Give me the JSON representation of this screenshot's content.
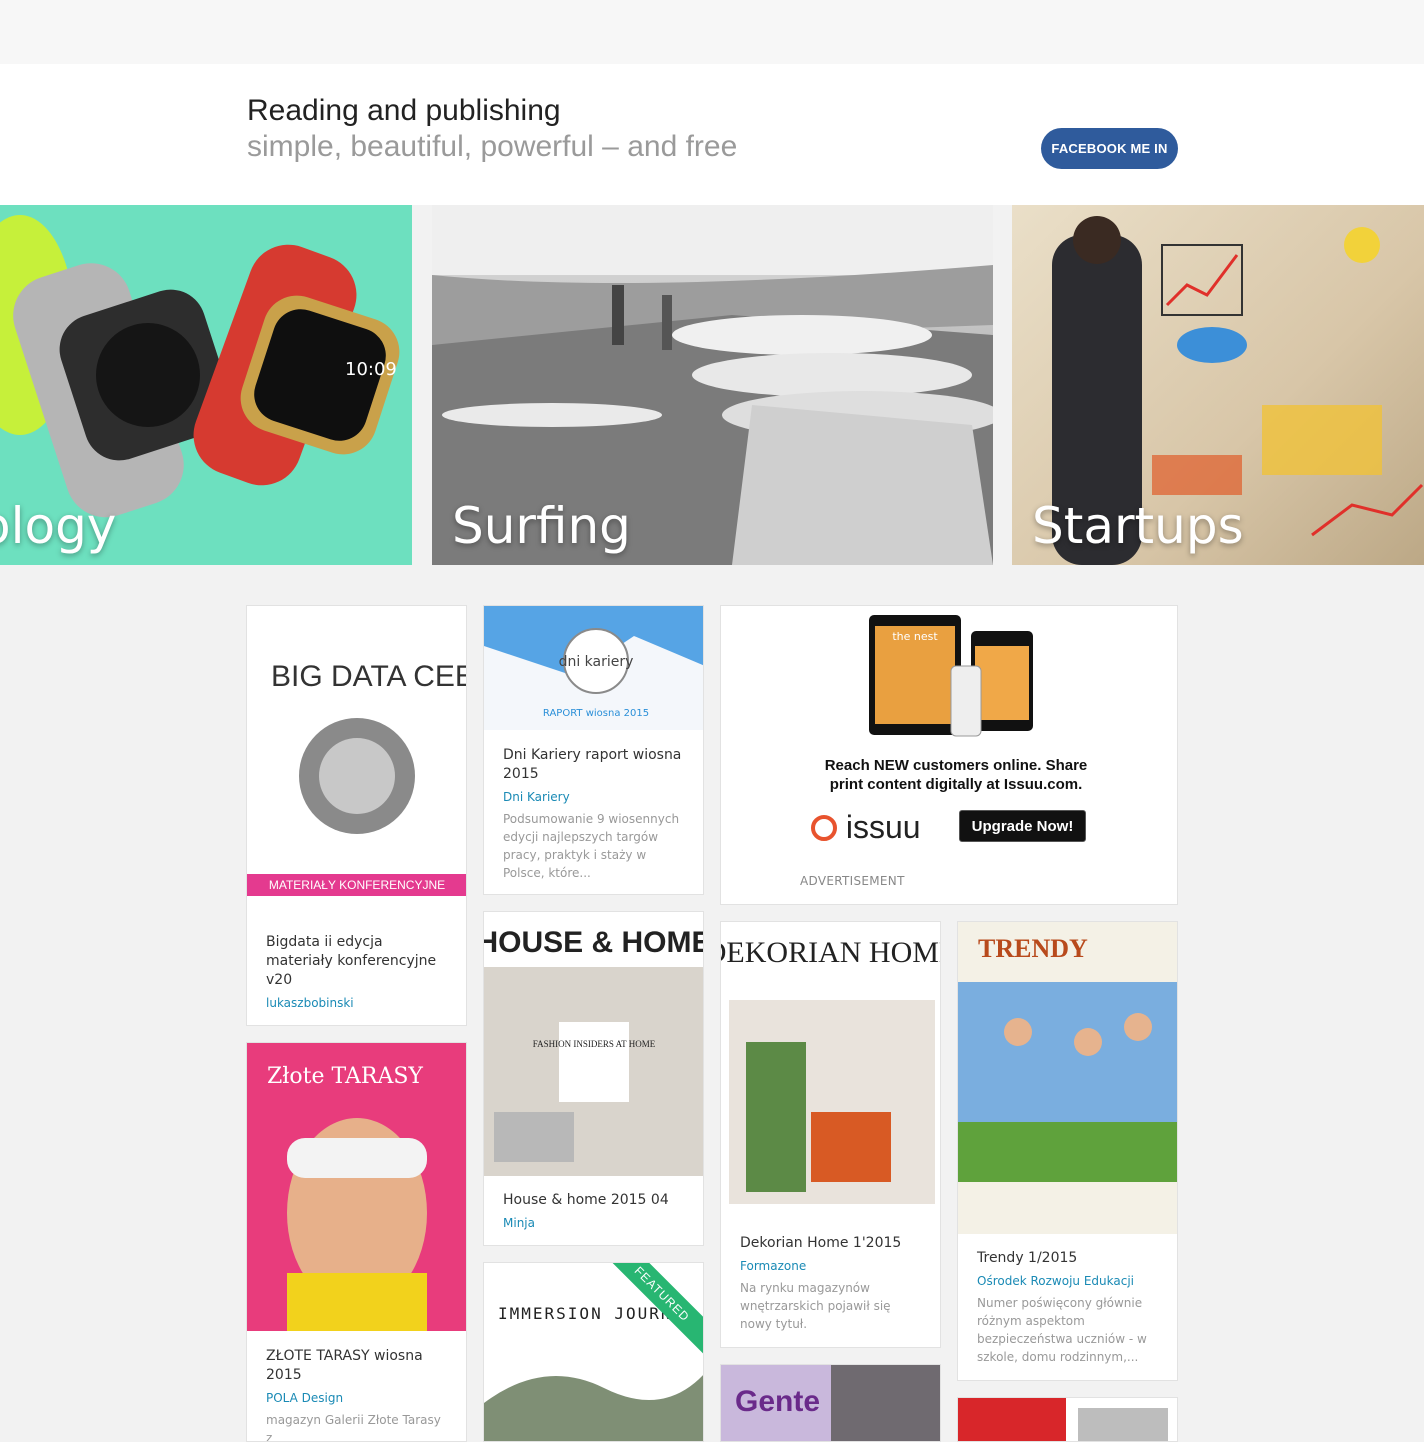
{
  "hero": {
    "title": "Reading and publishing",
    "subtitle": "simple, beautiful, powerful – and free",
    "facebook_button": "FACEBOOK ME IN"
  },
  "categories": [
    {
      "label": "Technology",
      "visible_text": "ology",
      "color": "#6de0bf"
    },
    {
      "label": "Surfing"
    },
    {
      "label": "Startups"
    }
  ],
  "ad": {
    "tagline": "Reach NEW customers online. Share print content digitally at Issuu.com.",
    "brand": "issuu",
    "upgrade_button": "Upgrade Now!",
    "label": "ADVERTISEMENT",
    "device_title": "the nest"
  },
  "publications": [
    {
      "title": "Bigdata ii edycja materiały konferencyjne v20",
      "author": "lukaszbobinski",
      "cover_text": "BIG DATA CEE CONGRESS",
      "cover_sub": "MATERIAŁY KONFERENCYJNE"
    },
    {
      "title": "Dni Kariery raport wiosna 2015",
      "author": "Dni Kariery",
      "description": "Podsumowanie 9 wiosennych edycji najlepszych targów pracy, praktyk i staży w Polsce, które...",
      "cover_text": "dni kariery",
      "cover_sub": "RAPORT wiosna 2015"
    },
    {
      "title": "House & home 2015 04",
      "author": "Minja",
      "cover_text": "HOUSE & HOME",
      "cover_sub": "FASHION INSIDERS AT HOME"
    },
    {
      "title": "Dekorian Home 1'2015",
      "author": "Formazone",
      "description": "Na rynku magazynów wnętrzarskich pojawił się nowy tytuł.",
      "cover_text": "DEKORIAN HOME"
    },
    {
      "title": "Trendy 1/2015",
      "author": "Ośrodek Rozwoju Edukacji",
      "description": "Numer poświęcony głównie różnym aspektom bezpieczeństwa uczniów - w szkole, domu rodzinnym,...",
      "cover_text": "TRENDY"
    },
    {
      "title": "ZŁOTE TARASY wiosna 2015",
      "author": "POLA Design",
      "description": "magazyn Galerii Złote Tarasy z",
      "cover_text": "Złote TARASY"
    },
    {
      "title": "",
      "cover_text": "IMMERSION JOURNAL",
      "badge": "FEATURED"
    },
    {
      "cover_text": "Gente"
    }
  ]
}
